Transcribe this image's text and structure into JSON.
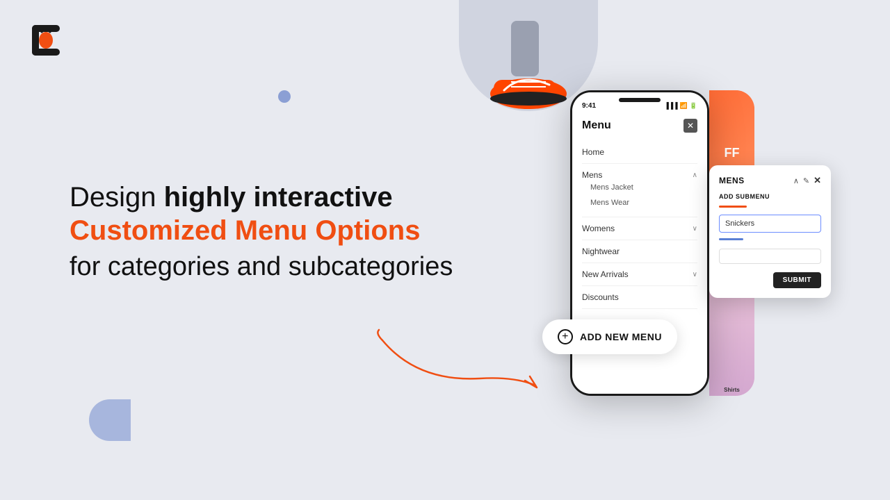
{
  "app": {
    "background_color": "#e8eaf0"
  },
  "logo": {
    "alt": "Logo"
  },
  "hero": {
    "line1_normal": "Design ",
    "line1_bold": "highly interactive",
    "line2": "Customized Menu Options",
    "line3": "for categories and subcategories",
    "accent_color": "#f04e12"
  },
  "add_menu_button": {
    "label": "ADD NEW MENU",
    "plus_icon": "+"
  },
  "phone": {
    "status_time": "9:41",
    "status_icons": "▐▐▐ ⚡ 🔋",
    "menu": {
      "title": "Menu",
      "close_icon": "✕",
      "items": [
        {
          "label": "Home",
          "has_submenu": false,
          "expanded": false
        },
        {
          "label": "Mens",
          "has_submenu": true,
          "expanded": true,
          "subitems": [
            "Mens Jacket",
            "Mens Wear"
          ]
        },
        {
          "label": "Womens",
          "has_submenu": true,
          "expanded": false
        },
        {
          "label": "Nightwear",
          "has_submenu": false,
          "expanded": false
        },
        {
          "label": "New Arrivals",
          "has_submenu": true,
          "expanded": false
        },
        {
          "label": "Discounts",
          "has_submenu": false,
          "expanded": false
        }
      ]
    }
  },
  "submenu_popup": {
    "title": "MENS",
    "edit_icon": "✎",
    "close_icon": "✕",
    "section_title": "ADD SUBMENU",
    "input_placeholder": "Snickers",
    "input_value": "Snickers",
    "submit_label": "SUBMIT"
  },
  "decorations": {
    "dot_color": "#8b9fd4",
    "half_circle_color": "#8b9fd4"
  }
}
